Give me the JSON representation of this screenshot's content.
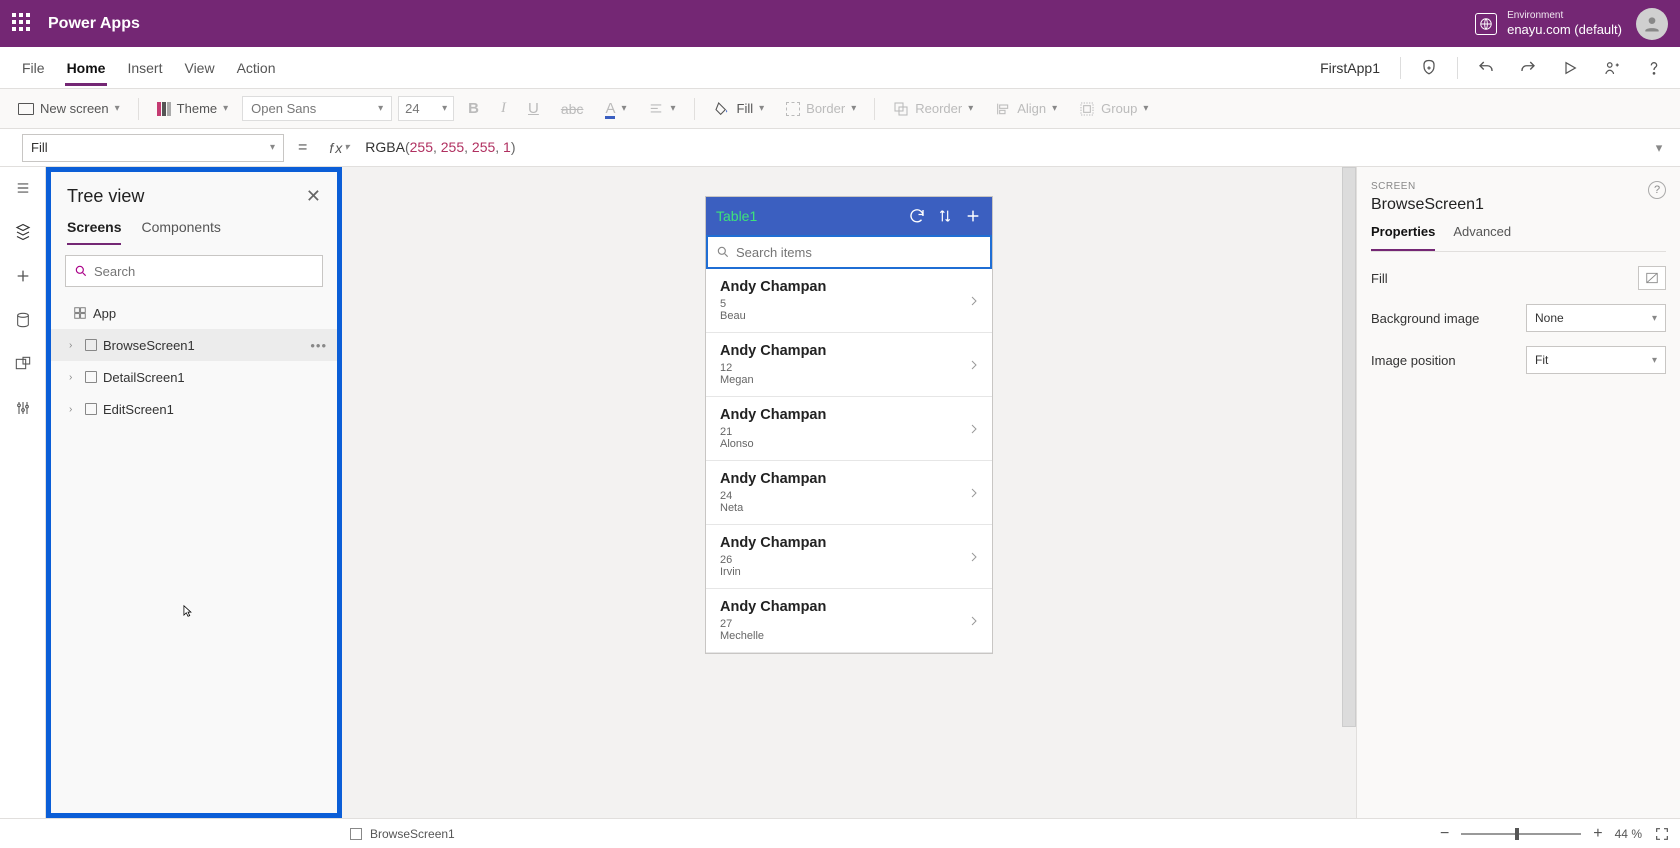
{
  "titlebar": {
    "app": "Power Apps",
    "env_label": "Environment",
    "env_name": "enayu.com (default)"
  },
  "menubar": {
    "items": [
      "File",
      "Home",
      "Insert",
      "View",
      "Action"
    ],
    "active": "Home",
    "app_name": "FirstApp1"
  },
  "ribbon": {
    "new_screen": "New screen",
    "theme": "Theme",
    "font": "Open Sans",
    "font_size": "24",
    "fill": "Fill",
    "border": "Border",
    "reorder": "Reorder",
    "align": "Align",
    "group": "Group"
  },
  "formulabar": {
    "property": "Fill",
    "fn": "RGBA",
    "args": [
      "255",
      "255",
      "255",
      "1"
    ]
  },
  "tree": {
    "title": "Tree view",
    "tabs": [
      "Screens",
      "Components"
    ],
    "active_tab": "Screens",
    "search_placeholder": "Search",
    "app_label": "App",
    "items": [
      {
        "label": "BrowseScreen1",
        "selected": true
      },
      {
        "label": "DetailScreen1",
        "selected": false
      },
      {
        "label": "EditScreen1",
        "selected": false
      }
    ]
  },
  "phone": {
    "title": "Table1",
    "search_placeholder": "Search items",
    "records": [
      {
        "title": "Andy Champan",
        "line1": "5",
        "line2": "Beau"
      },
      {
        "title": "Andy Champan",
        "line1": "12",
        "line2": "Megan"
      },
      {
        "title": "Andy Champan",
        "line1": "21",
        "line2": "Alonso"
      },
      {
        "title": "Andy Champan",
        "line1": "24",
        "line2": "Neta"
      },
      {
        "title": "Andy Champan",
        "line1": "26",
        "line2": "Irvin"
      },
      {
        "title": "Andy Champan",
        "line1": "27",
        "line2": "Mechelle"
      }
    ]
  },
  "right_panel": {
    "category": "SCREEN",
    "name": "BrowseScreen1",
    "tabs": [
      "Properties",
      "Advanced"
    ],
    "active_tab": "Properties",
    "fill_label": "Fill",
    "bg_label": "Background image",
    "bg_value": "None",
    "imgpos_label": "Image position",
    "imgpos_value": "Fit"
  },
  "statusbar": {
    "breadcrumb": "BrowseScreen1",
    "zoom_value": "44",
    "zoom_unit": "%"
  }
}
